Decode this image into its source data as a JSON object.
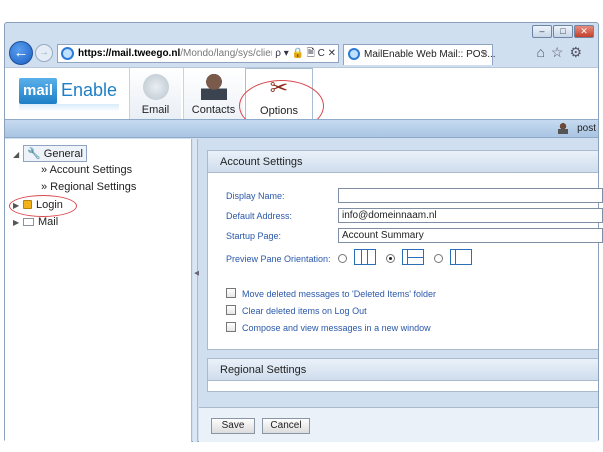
{
  "browser": {
    "address_bold": "https://mail.tweego.nl",
    "address_rest": "/Mondo/lang/sys/clien",
    "address_tools": "ρ ▾ 🔒 🗎 C ✕",
    "tab_title": "MailEnable Web Mail:: POS...",
    "tab_close": "×",
    "nav_tools": "⌂☆⚙",
    "back": "←",
    "forward": "→",
    "window_controls": {
      "min": "–",
      "max": "□",
      "close": "✕"
    }
  },
  "app": {
    "logo_mail": "mail",
    "logo_enable": "Enable",
    "nav": [
      {
        "label": "Email",
        "icon": "envelope-icon"
      },
      {
        "label": "Contacts",
        "icon": "person-icon"
      },
      {
        "label": "Options",
        "icon": "tools-icon"
      }
    ],
    "user_name": "post"
  },
  "tree": {
    "general": "General",
    "account_settings": "» Account Settings",
    "regional_settings": "» Regional Settings",
    "login": "Login",
    "mail": "Mail"
  },
  "account_settings": {
    "title": "Account Settings",
    "display_name_label": "Display Name:",
    "display_name_value": "",
    "default_address_label": "Default Address:",
    "default_address_value": "info@domeinnaam.nl",
    "startup_page_label": "Startup Page:",
    "startup_page_value": "Account Summary",
    "preview_label": "Preview Pane Orientation:",
    "preview_selected": "bottom",
    "checkboxes": [
      {
        "label": "Move deleted messages to 'Deleted Items' folder",
        "checked": false
      },
      {
        "label": "Clear deleted items on Log Out",
        "checked": false
      },
      {
        "label": "Compose and view messages in a new window",
        "checked": false
      }
    ]
  },
  "regional_settings": {
    "title": "Regional Settings"
  },
  "buttons": {
    "save": "Save",
    "cancel": "Cancel"
  },
  "colors": {
    "accent": "#1f7fc6",
    "annotation": "#d9484d",
    "label": "#2a58a8"
  }
}
